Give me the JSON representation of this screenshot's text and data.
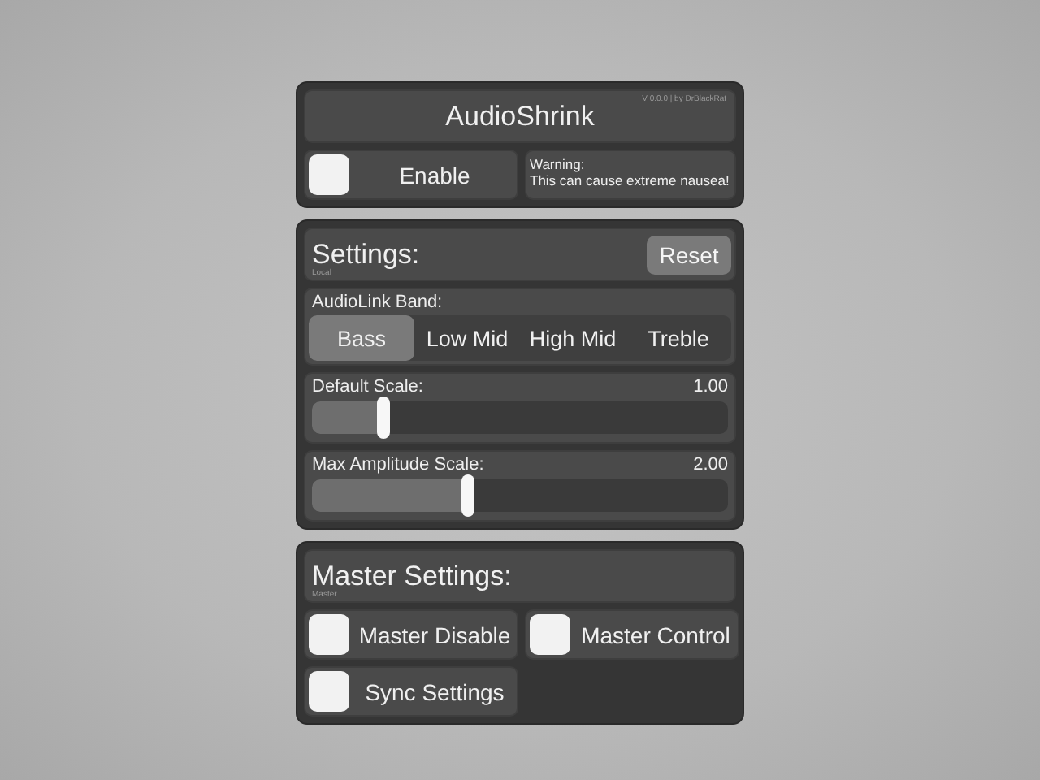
{
  "header": {
    "title": "AudioShrink",
    "version": "V 0.0.0 | by DrBlackRat",
    "enable": {
      "label": "Enable",
      "checked": false
    },
    "warning": {
      "heading": "Warning:",
      "text": "This can cause extreme nausea!"
    }
  },
  "settings": {
    "title": "Settings:",
    "subtitle": "Local",
    "reset": "Reset",
    "band": {
      "label": "AudioLink Band:",
      "options": [
        {
          "label": "Bass",
          "selected": true
        },
        {
          "label": "Low Mid",
          "selected": false
        },
        {
          "label": "High Mid",
          "selected": false
        },
        {
          "label": "Treble",
          "selected": false
        }
      ]
    },
    "sliders": [
      {
        "label": "Default Scale:",
        "reading": "1.00",
        "level": 0.17
      },
      {
        "label": "Max Amplitude Scale:",
        "reading": "2.00",
        "level": 0.375
      }
    ]
  },
  "master": {
    "title": "Master Settings:",
    "subtitle": "Master",
    "toggles": [
      {
        "label": "Master Disable",
        "checked": false
      },
      {
        "label": "Master Control",
        "checked": false
      },
      {
        "label": "Sync Settings",
        "checked": false
      }
    ]
  }
}
